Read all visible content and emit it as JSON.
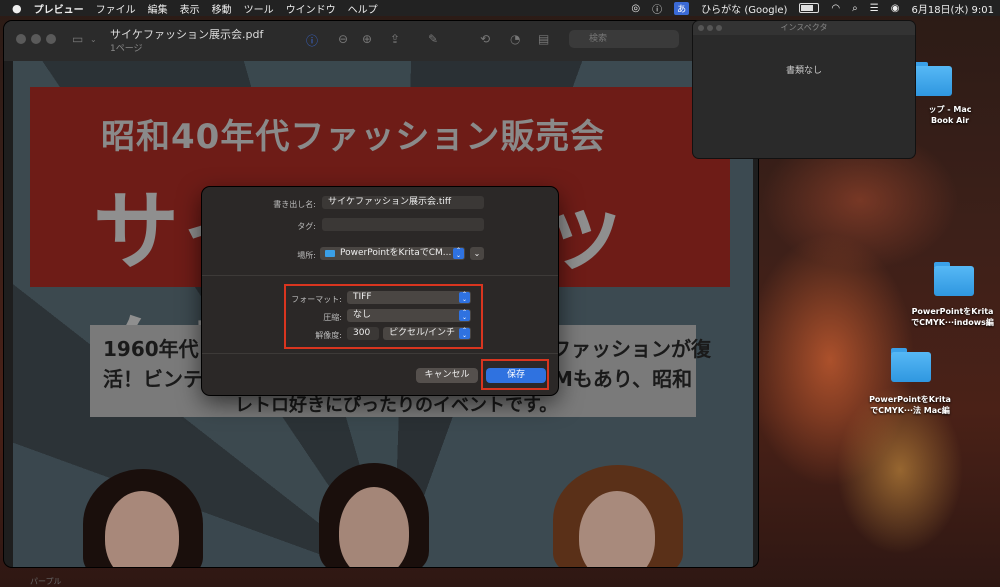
{
  "menubar": {
    "app": "プレビュー",
    "items": [
      "ファイル",
      "編集",
      "表示",
      "移動",
      "ツール",
      "ウインドウ",
      "ヘルプ"
    ],
    "ime_badge": "あ",
    "input_source": "ひらがな (Google)",
    "clock": "6月18日(水) 9:01"
  },
  "preview": {
    "title": "サイケファッション展示会.pdf",
    "subtitle": "1ページ",
    "search_placeholder": "検索"
  },
  "poster": {
    "headline_1": "昭和40年代ファッション販売会",
    "headline_2": "サイケデリック！",
    "line_1a": "1960年代",
    "line_1b": "ファッションが復",
    "line_2a": "活！ビンテ",
    "line_2b": "Mもあり、昭和",
    "line_3": "レトロ好きにぴったりのイベントです。"
  },
  "inspector": {
    "title": "インスペクタ",
    "message": "書類なし"
  },
  "desktop_items": [
    {
      "label_1": "ップ - Mac",
      "label_2": "Book Air"
    },
    {
      "label_1": "PowerPointをKrita",
      "label_2": "でCMYK···indows編"
    },
    {
      "label_1": "PowerPointをKrita",
      "label_2": "でCMYK···法 Mac編"
    }
  ],
  "save_dialog": {
    "export_as_label": "書き出し名:",
    "export_as_value": "サイケファッション展示会.tiff",
    "tags_label": "タグ:",
    "tags_value": "",
    "location_label": "場所:",
    "location_value": "PowerPointをKritaでCM...",
    "format_label": "フォーマット:",
    "format_value": "TIFF",
    "compression_label": "圧縮:",
    "compression_value": "なし",
    "resolution_label": "解像度:",
    "resolution_value": "300",
    "resolution_unit": "ピクセル/インチ",
    "cancel": "キャンセル",
    "save": "保存"
  },
  "dock_hint": "パープル",
  "colors": {
    "accent": "#2f72e0",
    "highlight_box": "#d9351f",
    "poster_banner": "#6e1c17",
    "folder": "#3aa0e8"
  }
}
